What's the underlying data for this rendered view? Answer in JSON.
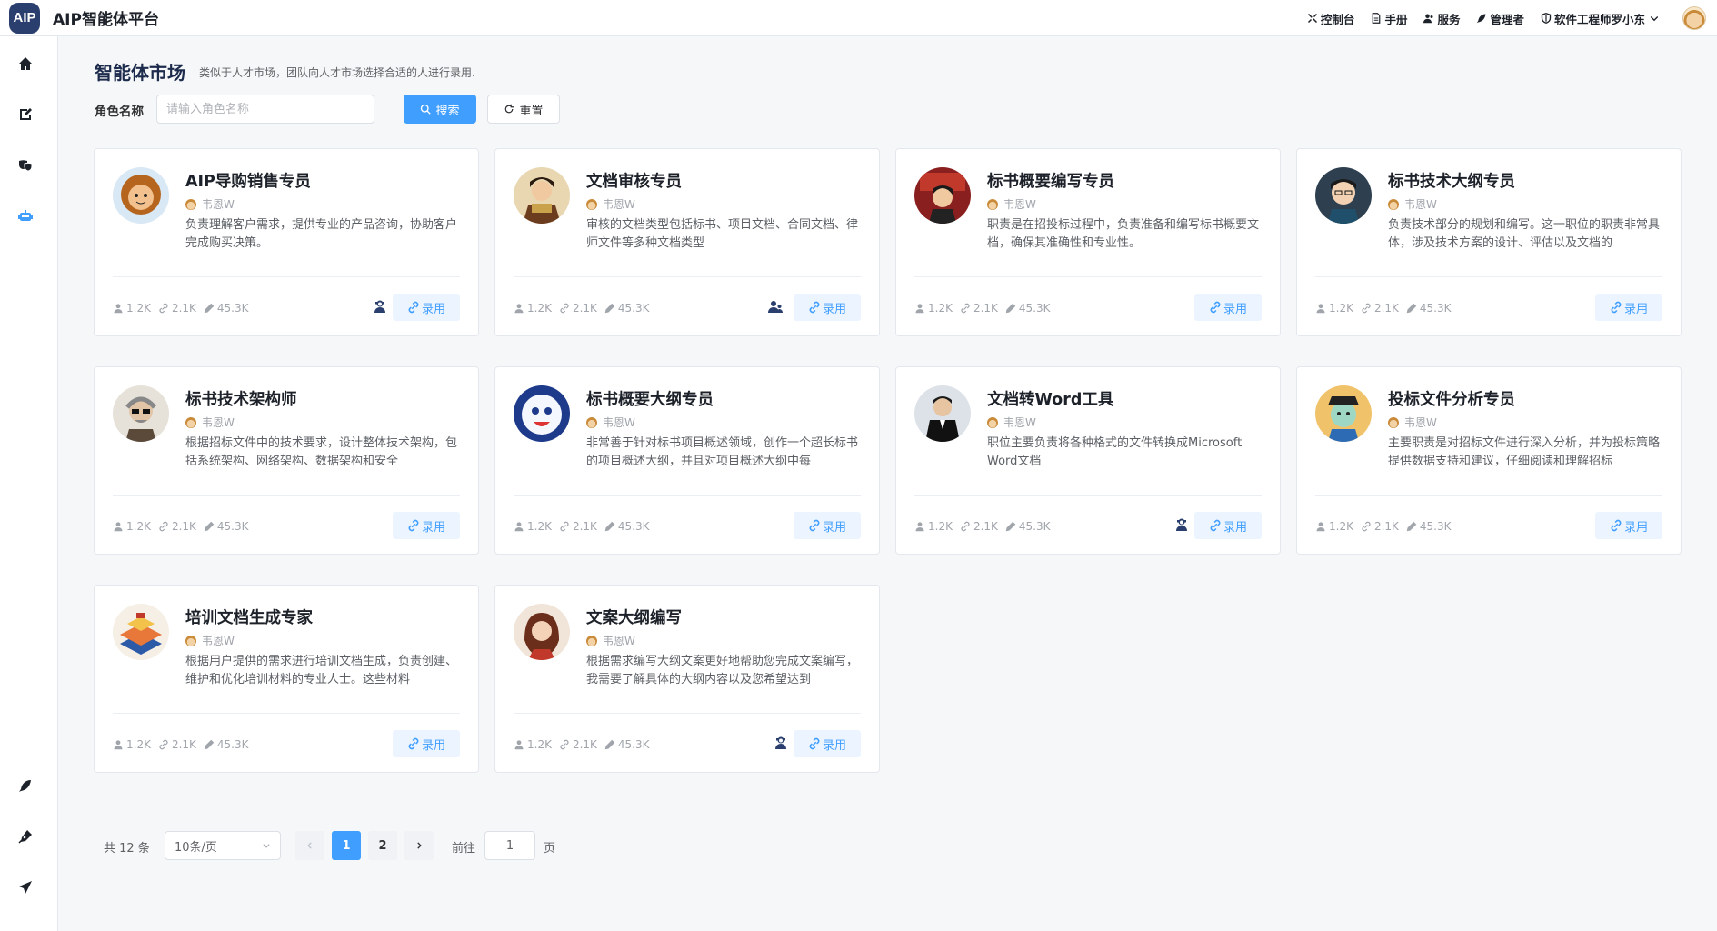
{
  "app": {
    "logo_text": "AIP",
    "title": "AIP智能体平台"
  },
  "topnav": [
    {
      "label": "控制台",
      "icon": "tools-icon"
    },
    {
      "label": "手册",
      "icon": "document-icon"
    },
    {
      "label": "服务",
      "icon": "users-icon"
    },
    {
      "label": "管理者",
      "icon": "feather-icon"
    },
    {
      "label": "软件工程师罗小东",
      "icon": "shield-icon"
    }
  ],
  "sidebar": [
    {
      "icon": "home-icon",
      "active": false
    },
    {
      "icon": "edit-icon",
      "active": false
    },
    {
      "icon": "masks-icon",
      "active": false
    },
    {
      "icon": "robot-icon",
      "active": true
    },
    {
      "icon": "feather-icon",
      "active": false
    },
    {
      "icon": "pen-nib-icon",
      "active": false
    },
    {
      "icon": "paper-plane-icon",
      "active": false
    }
  ],
  "header": {
    "title": "智能体市场",
    "description": "类似于人才市场，团队向人才市场选择合适的人进行录用."
  },
  "filter": {
    "label": "角色名称",
    "placeholder": "请输入角色名称",
    "search_label": "搜索",
    "reset_label": "重置"
  },
  "cards": [
    {
      "name": "AIP导购销售专员",
      "author": "韦恩W",
      "desc": "负责理解客户需求，提供专业的产品咨询，协助客户完成购买决策。",
      "users": "1.2K",
      "links": "2.1K",
      "uses": "45.3K",
      "hire": "录用",
      "mark": "agent-icon"
    },
    {
      "name": "文档审核专员",
      "author": "韦恩W",
      "desc": "审核的文档类型包括标书、项目文档、合同文档、律师文件等多种文档类型",
      "users": "1.2K",
      "links": "2.1K",
      "uses": "45.3K",
      "hire": "录用",
      "mark": "user-group-icon"
    },
    {
      "name": "标书概要编写专员",
      "author": "韦恩W",
      "desc": "职责是在招投标过程中，负责准备和编写标书概要文档，确保其准确性和专业性。",
      "users": "1.2K",
      "links": "2.1K",
      "uses": "45.3K",
      "hire": "录用",
      "mark": ""
    },
    {
      "name": "标书技术大纲专员",
      "author": "韦恩W",
      "desc": "负责技术部分的规划和编写。这一职位的职责非常具体，涉及技术方案的设计、评估以及文档的",
      "users": "1.2K",
      "links": "2.1K",
      "uses": "45.3K",
      "hire": "录用",
      "mark": ""
    },
    {
      "name": "标书技术架构师",
      "author": "韦恩W",
      "desc": "根据招标文件中的技术要求，设计整体技术架构，包括系统架构、网络架构、数据架构和安全",
      "users": "1.2K",
      "links": "2.1K",
      "uses": "45.3K",
      "hire": "录用",
      "mark": ""
    },
    {
      "name": "标书概要大纲专员",
      "author": "韦恩W",
      "desc": "非常善于针对标书项目概述领域，创作一个超长标书的项目概述大纲，并且对项目概述大纲中每",
      "users": "1.2K",
      "links": "2.1K",
      "uses": "45.3K",
      "hire": "录用",
      "mark": ""
    },
    {
      "name": "文档转Word工具",
      "author": "韦恩W",
      "desc": "职位主要负责将各种格式的文件转换成Microsoft Word文档",
      "users": "1.2K",
      "links": "2.1K",
      "uses": "45.3K",
      "hire": "录用",
      "mark": "agent-icon"
    },
    {
      "name": "投标文件分析专员",
      "author": "韦恩W",
      "desc": "主要职责是对招标文件进行深入分析，并为投标策略提供数据支持和建议，仔细阅读和理解招标",
      "users": "1.2K",
      "links": "2.1K",
      "uses": "45.3K",
      "hire": "录用",
      "mark": ""
    },
    {
      "name": "培训文档生成专家",
      "author": "韦恩W",
      "desc": "根据用户提供的需求进行培训文档生成，负责创建、维护和优化培训材料的专业人士。这些材料",
      "users": "1.2K",
      "links": "2.1K",
      "uses": "45.3K",
      "hire": "录用",
      "mark": ""
    },
    {
      "name": "文案大纲编写",
      "author": "韦恩W",
      "desc": "根据需求编写大纲文案更好地帮助您完成文案编写，我需要了解具体的大纲内容以及您希望达到",
      "users": "1.2K",
      "links": "2.1K",
      "uses": "45.3K",
      "hire": "录用",
      "mark": "agent-icon"
    }
  ],
  "pagination": {
    "total_label": "共 12 条",
    "page_size": "10条/页",
    "pages": [
      "1",
      "2"
    ],
    "current": "1",
    "goto_label": "前往",
    "goto_value": "1",
    "goto_suffix": "页"
  },
  "colors": {
    "primary": "#409eff",
    "hire_bg": "#ecf5ff",
    "brand_dark": "#2a3f6e",
    "sidebar_active": "#409eff"
  }
}
